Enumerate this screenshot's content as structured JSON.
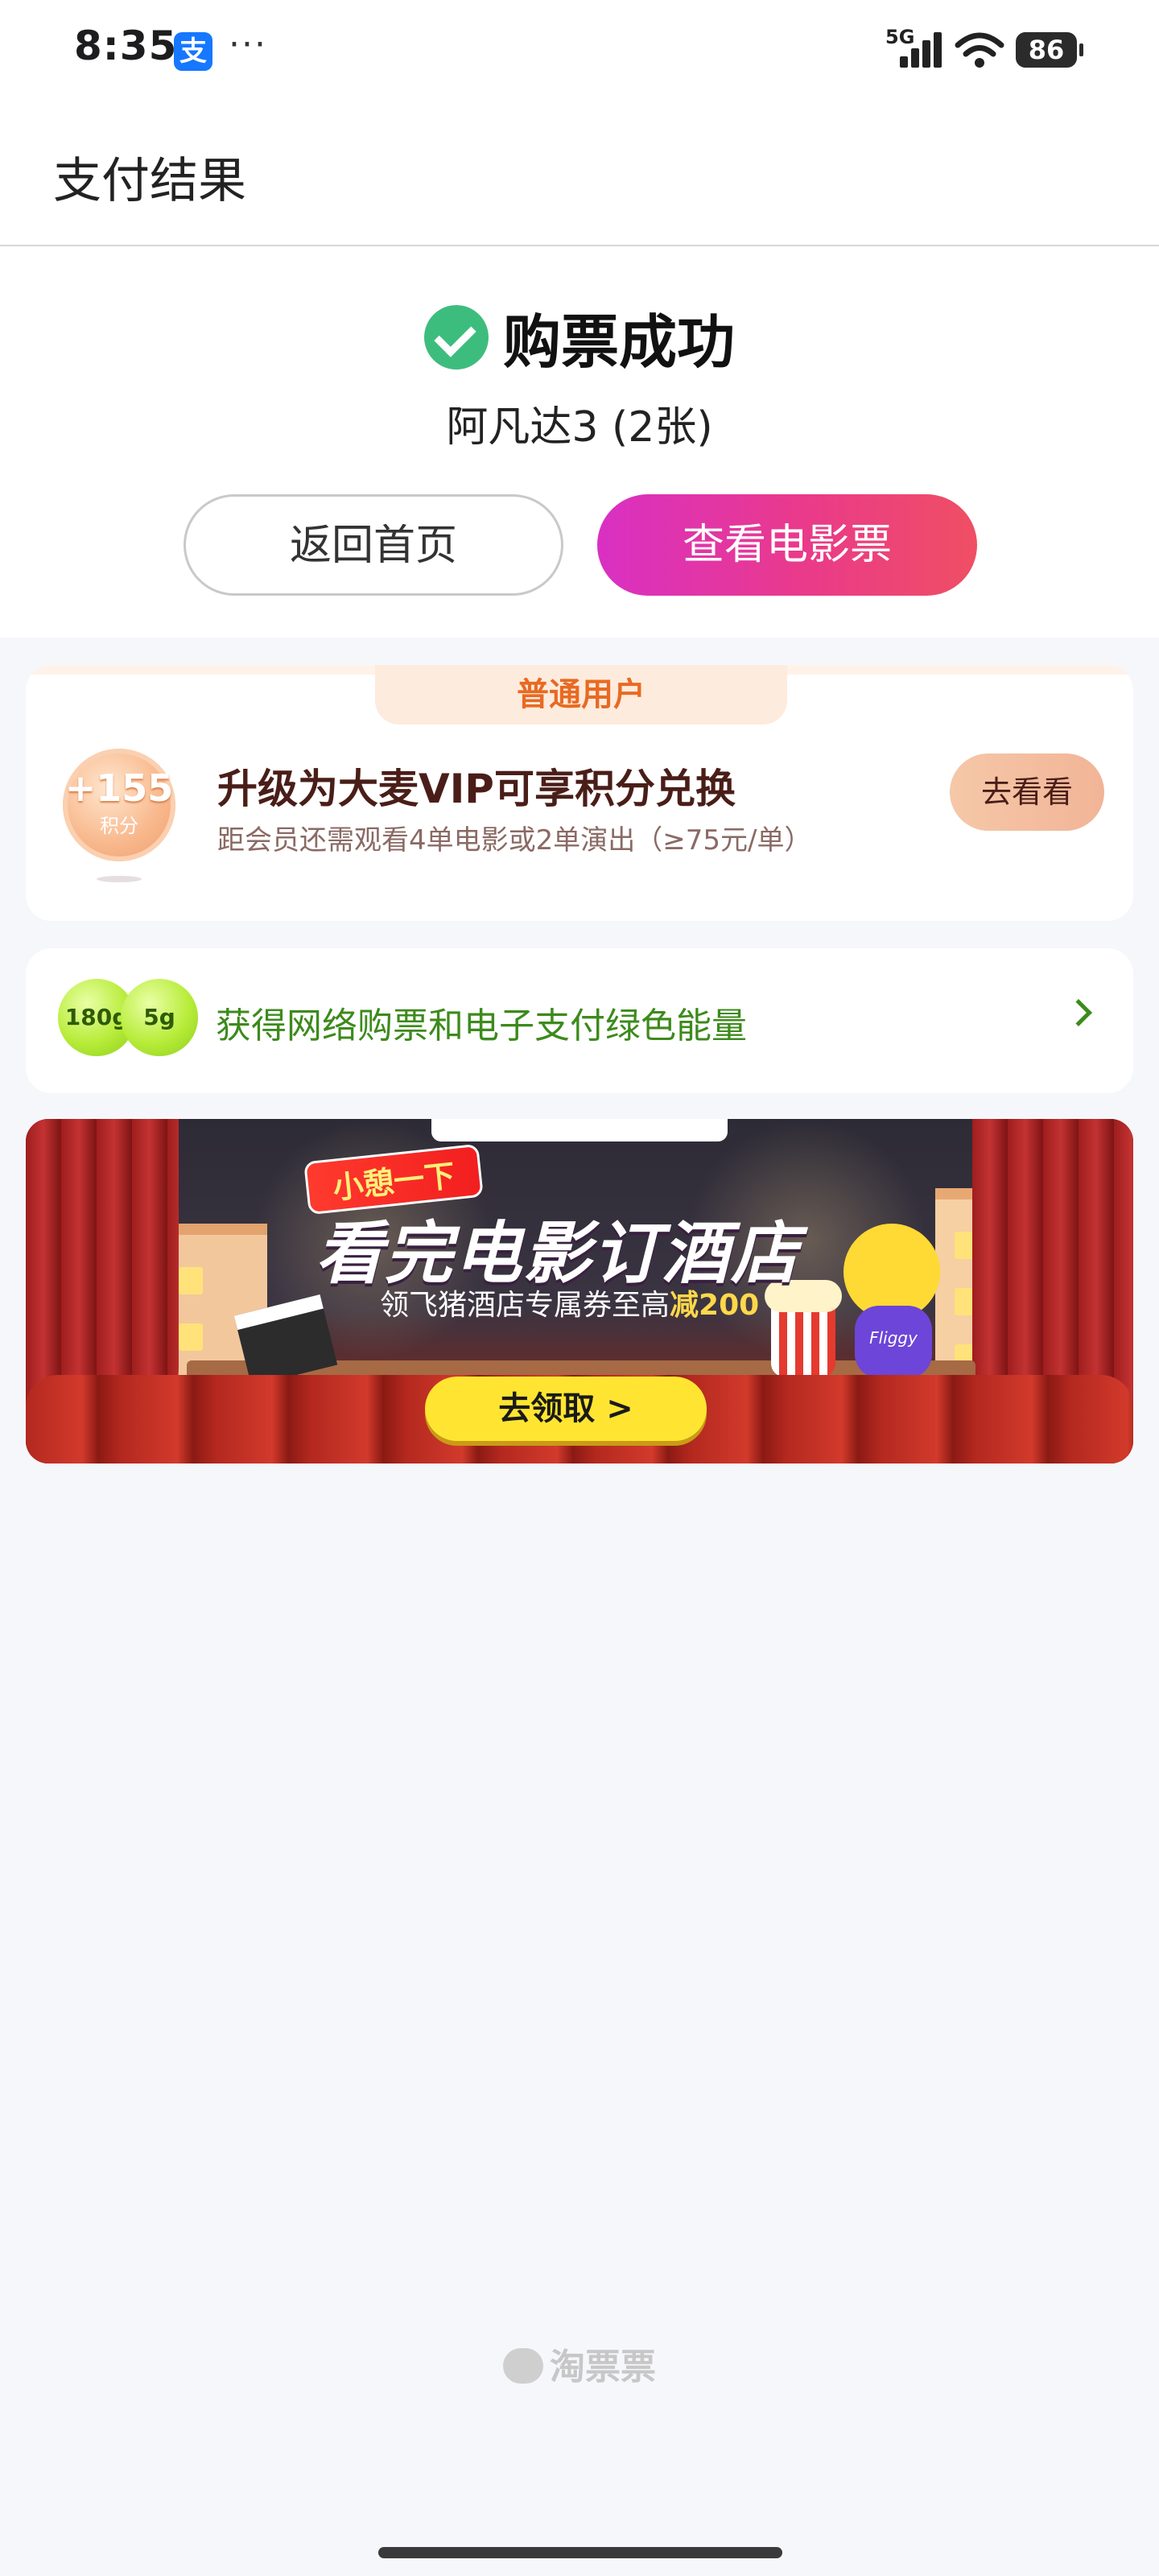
{
  "status_bar": {
    "time": "8:35",
    "app_icon": "支",
    "more": "···",
    "network": "5G",
    "battery": "86"
  },
  "nav": {
    "title": "支付结果"
  },
  "result": {
    "status": "购票成功",
    "movie": "阿凡达3 (2张)",
    "home_button": "返回首页",
    "view_ticket_button": "查看电影票"
  },
  "vip": {
    "tab": "普通用户",
    "points": "+155",
    "points_unit": "积分",
    "title": "升级为大麦VIP可享积分兑换",
    "subtitle": "距会员还需观看4单电影或2单演出（≥75元/单）",
    "button": "去看看"
  },
  "green_energy": {
    "ball1": "180g",
    "ball2": "5g",
    "text": "获得网络购票和电子支付绿色能量"
  },
  "banner": {
    "tag": "小憩一下",
    "title": "看完电影订酒店",
    "subtitle_prefix": "领飞猪酒店专属券至高",
    "subtitle_highlight": "减200",
    "mascot_label": "Fliggy",
    "button": "去领取 >"
  },
  "footer": {
    "brand": "淘票票"
  }
}
